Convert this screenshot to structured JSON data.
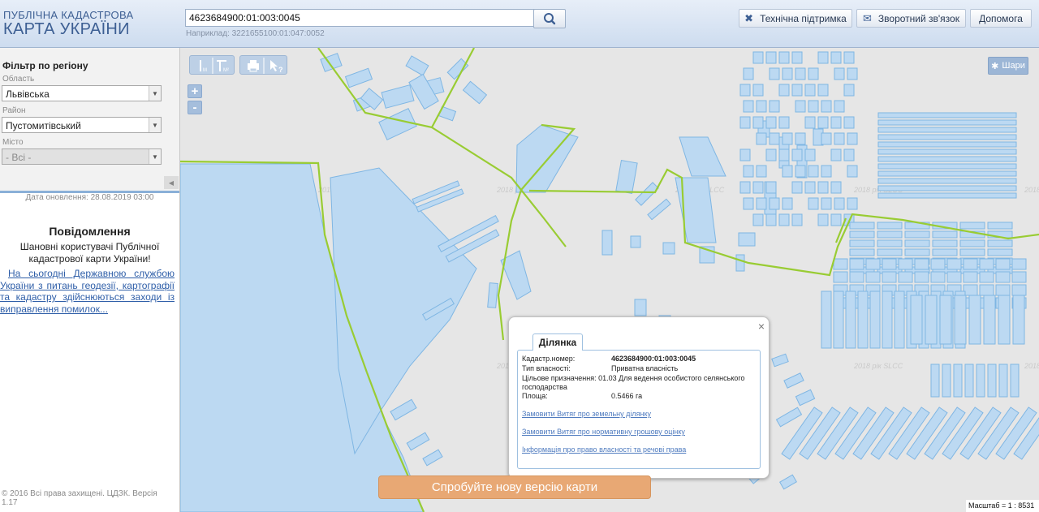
{
  "header": {
    "logo_line1": "ПУБЛІЧНА КАДАСТРОВА",
    "logo_line2": "КАРТА УКРАЇНИ",
    "search_value": "4623684900:01:003:0045",
    "search_hint": "Наприклад: 3221655100:01:047:0052",
    "support_label": "Технічна підтримка",
    "feedback_label": "Зворотний зв'язок",
    "help_label": "Допомога"
  },
  "filter": {
    "title": "Фільтр по регіону",
    "region_label": "Область",
    "region_value": "Львівська",
    "district_label": "Район",
    "district_value": "Пустомитівський",
    "city_label": "Місто",
    "city_value": "- Всі -"
  },
  "left": {
    "updated": "Дата оновлення: 28.08.2019 03:00",
    "notice_title": "Повідомлення",
    "notice_text": "Шановні користувачі Публічної кадастрової карти України!",
    "notice_link": "На сьогодні Державною службою України з питань геодезії, картографії та кадастру здійснюються заходи із виправлення помилок...",
    "copyright": "© 2016 Всі права захищені. ЦДЗК. Версія 1.17"
  },
  "map": {
    "layers_label": "Шари",
    "zoom_in": "+",
    "zoom_out": "-",
    "watermark": "2018 рік SLCC",
    "new_version": "Спробуйте нову версію карти",
    "scale": "Масштаб = 1 : 8531"
  },
  "popup": {
    "tab": "Ділянка",
    "close": "×",
    "rows": [
      {
        "key": "Кадастр.номер:",
        "value": "4623684900:01:003:0045"
      },
      {
        "key": "Тип власності:",
        "value": "Приватна власність"
      },
      {
        "key": "Цільове призначення:",
        "value": "01.03 Для ведення особистого селянського господарства"
      },
      {
        "key": "Площа:",
        "value": "0.5466 га"
      }
    ],
    "links": [
      "Замовити Витяг про земельну ділянку",
      "Замовити Витяг про нормативну грошову оцінку",
      "Інформація про право власності та речові права"
    ]
  },
  "colors": {
    "parcel_fill": "#bcd9f2",
    "parcel_stroke": "#7fb6e3",
    "boundary": "#99cc33",
    "accent": "#3d5f93"
  }
}
